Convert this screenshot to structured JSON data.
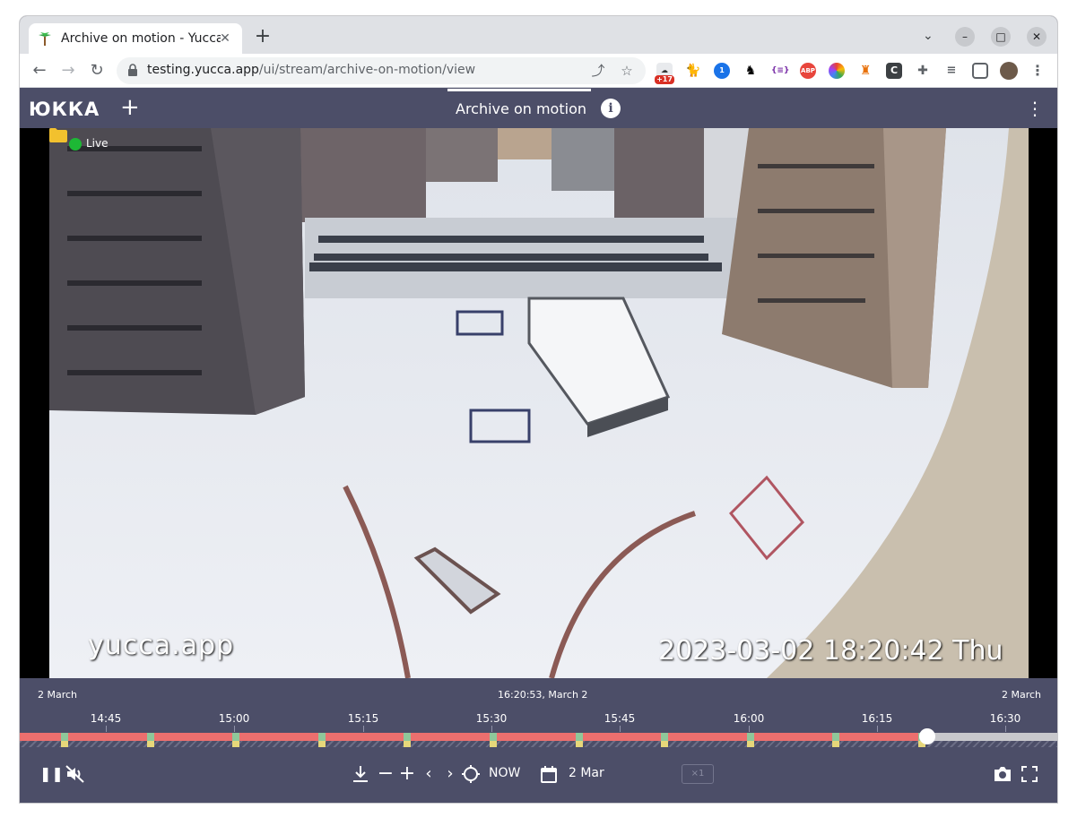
{
  "browser": {
    "tab_title": "Archive on motion - Yucca",
    "url_host": "testing.yucca.app",
    "url_path": "/ui/stream/archive-on-motion/view",
    "badge_count": "+17"
  },
  "app": {
    "logo": "ЮККА",
    "page_title": "Archive on motion"
  },
  "video": {
    "live_label": "Live",
    "watermark": "yucca.app",
    "timestamp": "2023-03-02 18:20:42 Thu"
  },
  "timeline": {
    "left_date": "2 March",
    "center_time": "16:20:53, March 2",
    "right_date": "2 March",
    "ticks": [
      "14:45",
      "15:00",
      "15:15",
      "15:30",
      "15:45",
      "16:00",
      "16:15",
      "16:30"
    ]
  },
  "controls": {
    "now_label": "NOW",
    "date_label": "2 Mar",
    "speed_label": "×1"
  },
  "colors": {
    "app_bg": "#4c4e68",
    "recorded": "#ec6f6e",
    "live_dot": "#1db835",
    "motion": "#8fc79a"
  }
}
